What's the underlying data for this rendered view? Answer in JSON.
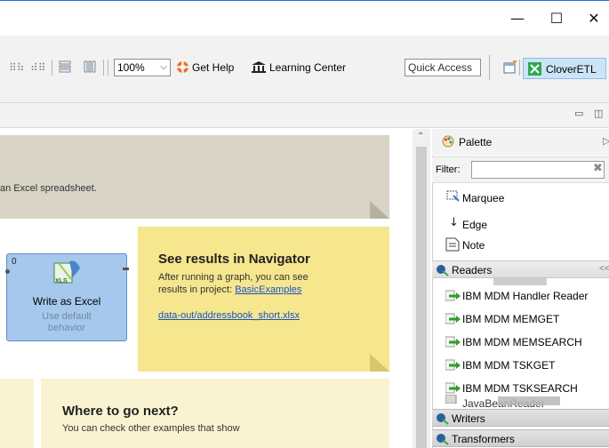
{
  "window": {
    "minimize": "—",
    "maximize": "☐",
    "close": "✕"
  },
  "toolbar": {
    "zoom_value": "100%",
    "get_help": "Get Help",
    "learning_center": "Learning Center",
    "quick_access": "Quick Access",
    "perspective": "CloverETL"
  },
  "canvas": {
    "intro_note_text": "an Excel spreadsheet.",
    "component": {
      "port_count": "0",
      "icon_label": "XLS",
      "title": "Write as Excel",
      "subtitle_line1": "Use default",
      "subtitle_line2": "behavior"
    },
    "results_note": {
      "title": "See results in Navigator",
      "line1": "After running a graph, you can see",
      "line2_prefix": "results in project: ",
      "project_link": "BasicExamples",
      "file_link": "data-out/addressbook_short.xlsx"
    },
    "next_note": {
      "title": "Where to go next?",
      "body": "You can check other examples that show"
    }
  },
  "palette": {
    "title": "Palette",
    "filter_label": "Filter:",
    "tools": {
      "marquee": "Marquee",
      "edge": "Edge",
      "note": "Note"
    },
    "drawers": {
      "readers": "Readers",
      "writers": "Writers",
      "transformers": "Transformers"
    },
    "readers": [
      "IBM MDM Handler Reader",
      "IBM MDM MEMGET",
      "IBM MDM MEMSEARCH",
      "IBM MDM TSKGET",
      "IBM MDM TSKSEARCH"
    ],
    "partial_reader": "JavaBeanReader"
  },
  "colors": {
    "grey_note": "#d8d4c6",
    "yellow_note": "#f6e68e",
    "cream_note": "#faf3d2",
    "component_fill": "#a6c8ec",
    "link": "#1a52c6",
    "reader_arrow": "#2e9e2e"
  }
}
